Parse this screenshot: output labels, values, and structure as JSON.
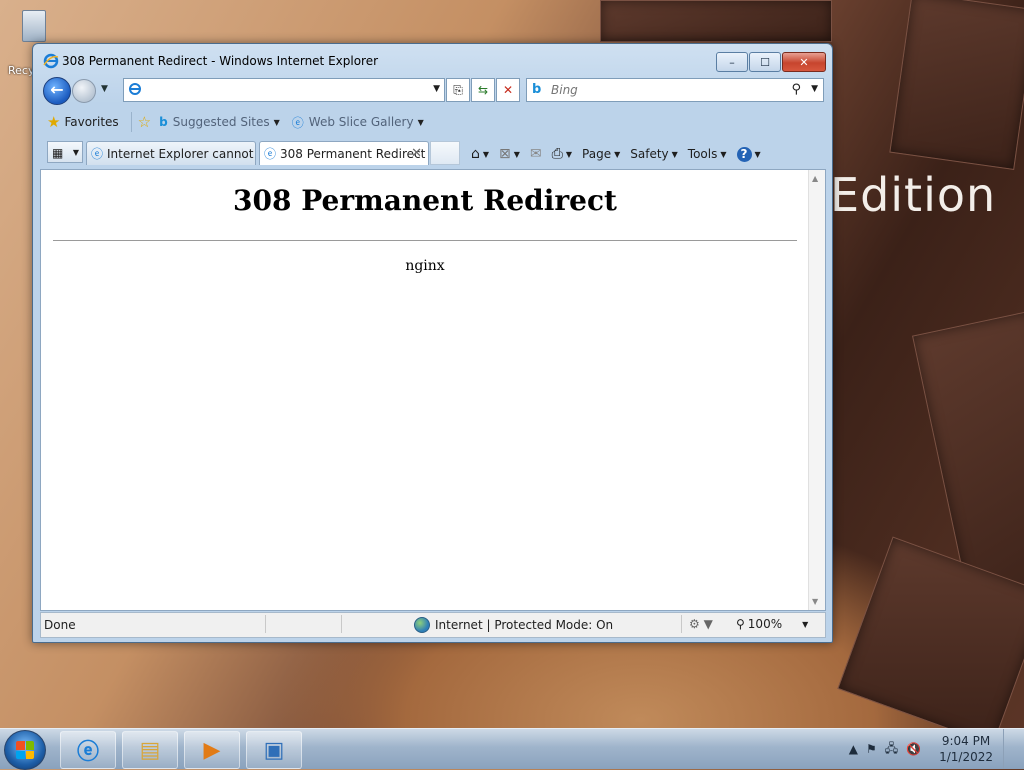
{
  "desktop": {
    "recycle_bin_label": "Recyc",
    "wallpaper_text": "Edition"
  },
  "window": {
    "title": "308 Permanent Redirect - Windows Internet Explorer",
    "controls": {
      "minimize": "–",
      "maximize": "☐",
      "close": "✕"
    }
  },
  "navbar": {
    "address_value": "",
    "search_placeholder": "Bing",
    "address_buttons": [
      "compat-view",
      "refresh",
      "stop"
    ]
  },
  "favorites_bar": {
    "favorites_label": "Favorites",
    "items": [
      {
        "label": "Suggested Sites",
        "icon": "bing-icon"
      },
      {
        "label": "Web Slice Gallery",
        "icon": "ie-page-icon"
      }
    ]
  },
  "tabs": [
    {
      "label": "Internet Explorer cannot ...",
      "active": false
    },
    {
      "label": "308 Permanent Redirect",
      "active": true
    }
  ],
  "command_bar": {
    "page": "Page",
    "safety": "Safety",
    "tools": "Tools",
    "help": "?"
  },
  "page": {
    "heading": "308 Permanent Redirect",
    "server": "nginx"
  },
  "statusbar": {
    "status": "Done",
    "zone": "Internet | Protected Mode: On",
    "zoom": "100%"
  },
  "taskbar": {
    "time": "9:04 PM",
    "date": "1/1/2022"
  },
  "colors": {
    "window_frame": "#bcd3ea",
    "taskbar": "#9fb4cb",
    "close_button": "#c7452e"
  }
}
